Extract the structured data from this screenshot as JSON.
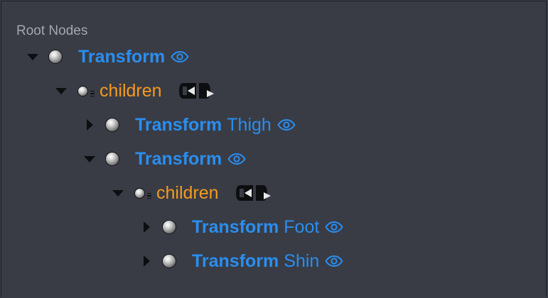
{
  "panel": {
    "title": "Root Nodes"
  },
  "tree": [
    {
      "kind": "node",
      "type": "Transform",
      "name": "",
      "expanded": true,
      "icon": "sphere-icon"
    },
    {
      "kind": "field",
      "name": "children",
      "expanded": true,
      "icon": "field-sphere-icon"
    },
    {
      "kind": "node",
      "type": "Transform",
      "name": "Thigh",
      "expanded": false,
      "icon": "sphere-icon"
    },
    {
      "kind": "node",
      "type": "Transform",
      "name": "",
      "expanded": true,
      "icon": "sphere-icon"
    },
    {
      "kind": "field",
      "name": "children",
      "expanded": true,
      "icon": "field-sphere-icon"
    },
    {
      "kind": "node",
      "type": "Transform",
      "name": "Foot",
      "expanded": false,
      "icon": "sphere-icon"
    },
    {
      "kind": "node",
      "type": "Transform",
      "name": "Shin",
      "expanded": false,
      "icon": "sphere-icon"
    }
  ],
  "colors": {
    "background": "#393c45",
    "node_text": "#2a8ef0",
    "field_text": "#f39a20",
    "label_text": "#a3a7b0",
    "eye_icon": "#2a8ef0"
  }
}
